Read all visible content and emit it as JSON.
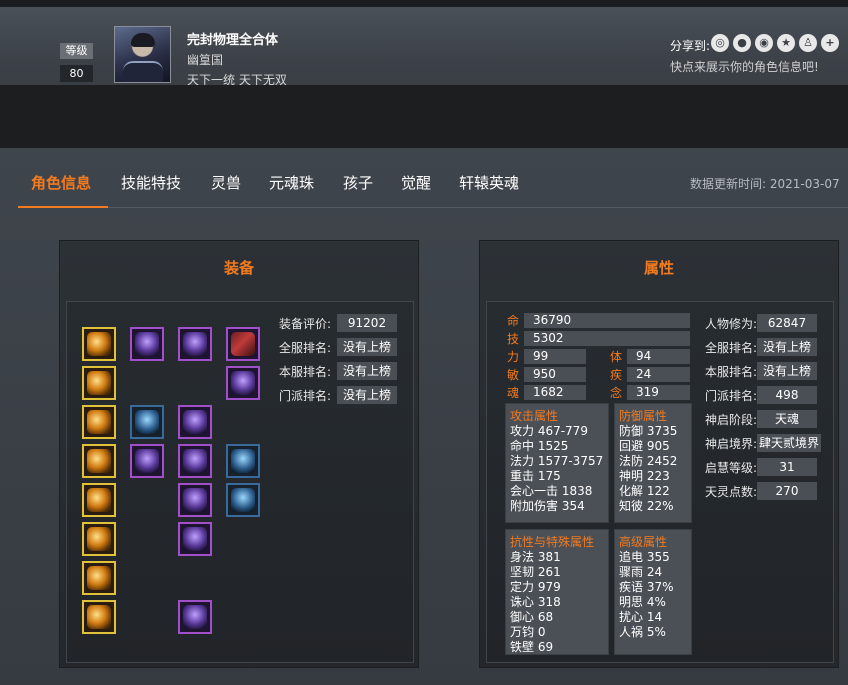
{
  "header": {
    "level_label": "等级",
    "level_value": "80",
    "char_name": "完封物理全合体",
    "server": "幽篁国",
    "guild": "天下一统 天下无双",
    "share_label": "分享到:",
    "share_icons": [
      "wechat-icon",
      "qzone-icon",
      "weibo-icon",
      "star-icon",
      "people-icon",
      "plus-icon"
    ],
    "share_hint": "快点来展示你的角色信息吧!"
  },
  "tabs": [
    "角色信息",
    "技能特技",
    "灵兽",
    "元魂珠",
    "孩子",
    "觉醒",
    "轩辕英魂"
  ],
  "update": {
    "label": "数据更新时间:",
    "date": "2021-03-07"
  },
  "equipment": {
    "title": "装备",
    "score_label": "装备评价:",
    "score": "91202",
    "server_rank_label": "全服排名:",
    "server_rank": "没有上榜",
    "local_rank_label": "本服排名:",
    "local_rank": "没有上榜",
    "sect_rank_label": "门派排名:",
    "sect_rank": "没有上榜"
  },
  "attributes": {
    "title": "属性",
    "life_label": "命",
    "life": "36790",
    "skill_label": "技",
    "skill": "5302",
    "str_label": "力",
    "str": "99",
    "con_label": "体",
    "con": "94",
    "agi_label": "敏",
    "agi": "950",
    "dex_label": "疾",
    "dex": "24",
    "soul_label": "魂",
    "soul": "1682",
    "mind_label": "念",
    "mind": "319",
    "attack": {
      "title": "攻击属性",
      "rows": [
        "攻力 467-779",
        "命中 1525",
        "法力 1577-3757",
        "重击 175",
        "会心一击 1838",
        "附加伤害 354"
      ]
    },
    "defense": {
      "title": "防御属性",
      "rows": [
        "防御 3735",
        "回避 905",
        "法防 2452",
        "神明 223",
        "化解 122",
        "知彼 22%"
      ]
    },
    "resist": {
      "title": "抗性与特殊属性",
      "rows": [
        "身法 381",
        "坚韧 261",
        "定力 979",
        "诛心 318",
        "御心 68",
        "万钧 0",
        "铁壁 69"
      ]
    },
    "advanced": {
      "title": "高级属性",
      "rows": [
        "追电 355",
        "骤雨 24",
        "疾语 37%",
        "明思 4%",
        "扰心 14",
        "人祸 5%"
      ]
    },
    "right": {
      "cultivation_label": "人物修为:",
      "cultivation": "62847",
      "server_rank_label": "全服排名:",
      "server_rank": "没有上榜",
      "local_rank_label": "本服排名:",
      "local_rank": "没有上榜",
      "sect_rank_label": "门派排名:",
      "sect_rank": "498",
      "realm_stage_label": "神启阶段:",
      "realm_stage": "天魂",
      "realm_label": "神启境界:",
      "realm": "肆天贰境界",
      "wisdom_label": "启慧等级:",
      "wisdom": "31",
      "spirit_label": "天灵点数:",
      "spirit": "270"
    }
  }
}
